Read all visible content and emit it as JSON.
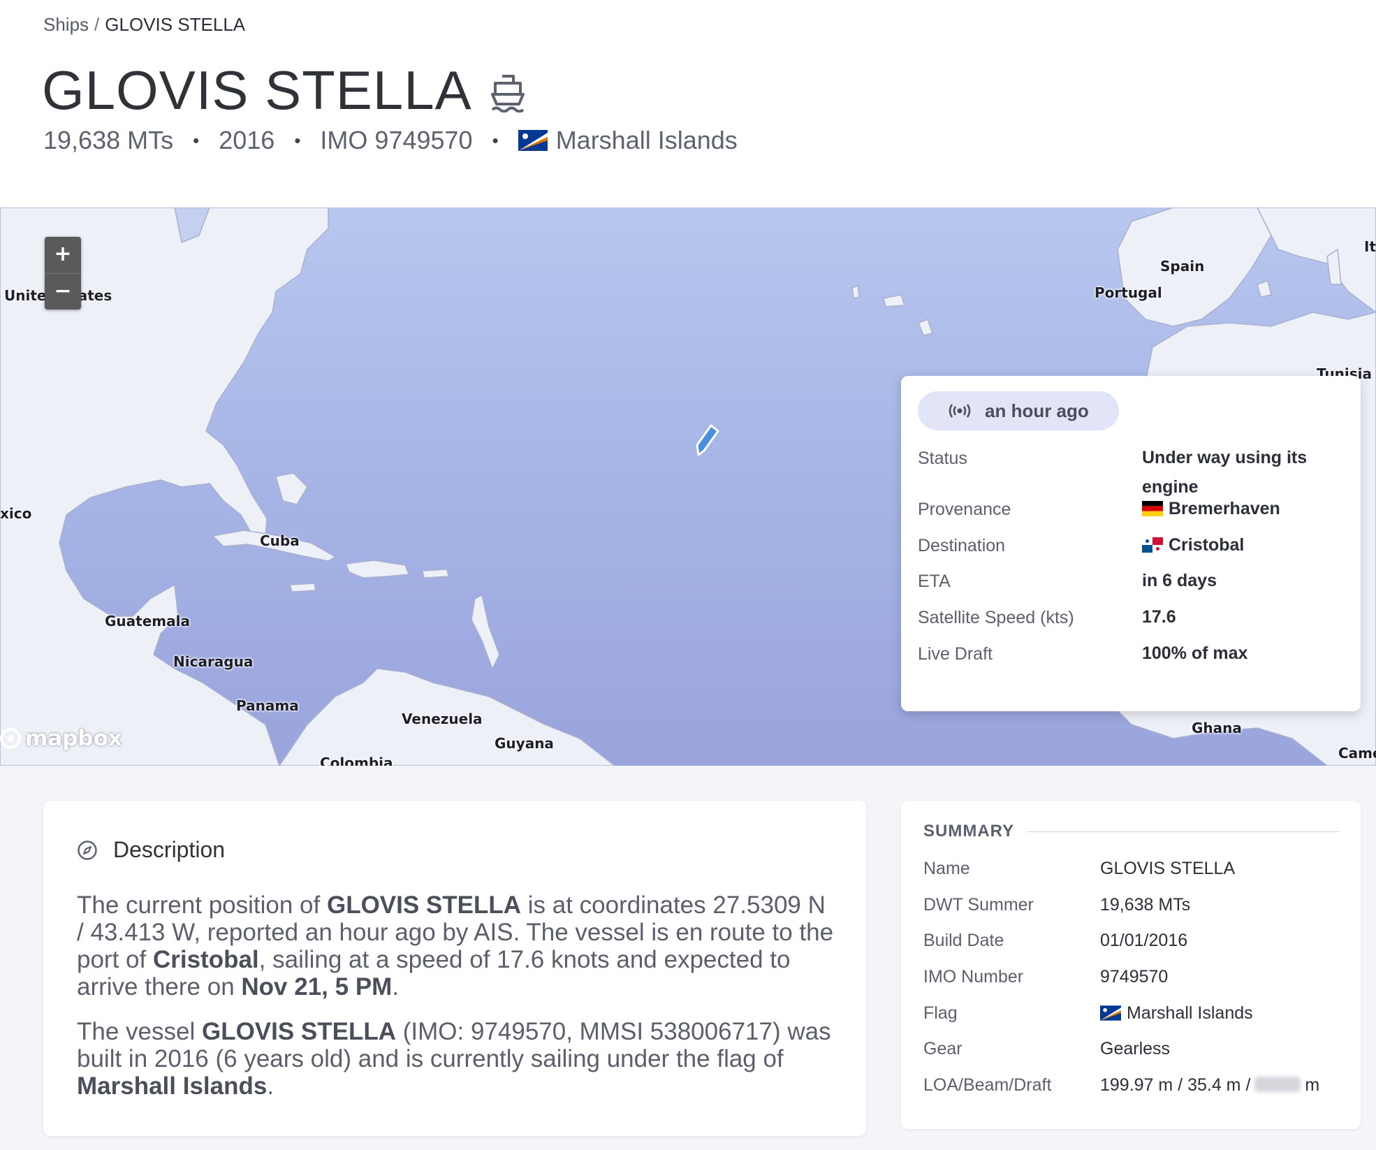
{
  "breadcrumb": {
    "parent": "Ships",
    "separator": "/",
    "current": "GLOVIS STELLA"
  },
  "ship": {
    "name": "GLOVIS STELLA",
    "dwt": "19,638 MTs",
    "year": "2016",
    "imo": "IMO 9749570",
    "flag": "Marshall Islands"
  },
  "map": {
    "zoom_in": "+",
    "zoom_out": "−",
    "attribution": "mapbox",
    "countries": {
      "united_states": "United States",
      "mexico": "xico",
      "cuba": "Cuba",
      "guatemala": "Guatemala",
      "nicaragua": "Nicaragua",
      "panama": "Panama",
      "venezuela": "Venezuela",
      "colombia": "Colombia",
      "guyana": "Guyana",
      "spain": "Spain",
      "portugal": "Portugal",
      "tunisia": "Tunisia",
      "ghana": "Ghana",
      "cameroon": "Came",
      "italy": "It"
    }
  },
  "popup": {
    "last_seen": "an hour ago",
    "rows": [
      {
        "label": "Status",
        "value": "Under way using its engine"
      },
      {
        "label": "Provenance",
        "value": "Bremerhaven"
      },
      {
        "label": "Destination",
        "value": "Cristobal"
      },
      {
        "label": "ETA",
        "value": "in 6 days"
      },
      {
        "label": "Satellite Speed (kts)",
        "value": "17.6"
      },
      {
        "label": "Live Draft",
        "value": "100% of max"
      }
    ]
  },
  "description": {
    "heading": "Description",
    "p1": {
      "t1": "The current position of ",
      "name": "GLOVIS STELLA",
      "t2": " is at coordinates 27.5309 N / 43.413 W, reported an hour ago by AIS. The vessel is en route to the port of ",
      "port": "Cristobal",
      "t3": ", sailing at a speed of 17.6 knots and expected to arrive there on ",
      "date": "Nov 21, 5 PM",
      "t4": "."
    },
    "p2": {
      "t1": "The vessel ",
      "name": "GLOVIS STELLA",
      "t2": " (IMO: 9749570, MMSI 538006717) was built in 2016 (6 years old) and is currently sailing under the flag of ",
      "flag": "Marshall Islands",
      "t3": "."
    }
  },
  "summary": {
    "title": "SUMMARY",
    "rows": [
      {
        "label": "Name",
        "value": "GLOVIS STELLA"
      },
      {
        "label": "DWT Summer",
        "value": "19,638 MTs"
      },
      {
        "label": "Build Date",
        "value": "01/01/2016"
      },
      {
        "label": "IMO Number",
        "value": "9749570"
      },
      {
        "label": "Flag",
        "value": "Marshall Islands"
      },
      {
        "label": "Gear",
        "value": "Gearless"
      },
      {
        "label": "LOA/Beam/Draft",
        "value": "199.97 m / 35.4 m /",
        "suffix": "m"
      }
    ]
  },
  "colors": {
    "ocean_top": "#b7c7ee",
    "ocean_bottom": "#9aa4dd",
    "land": "#eef0f8",
    "marker": "#4a90e2",
    "pill": "#e2e4f7"
  }
}
